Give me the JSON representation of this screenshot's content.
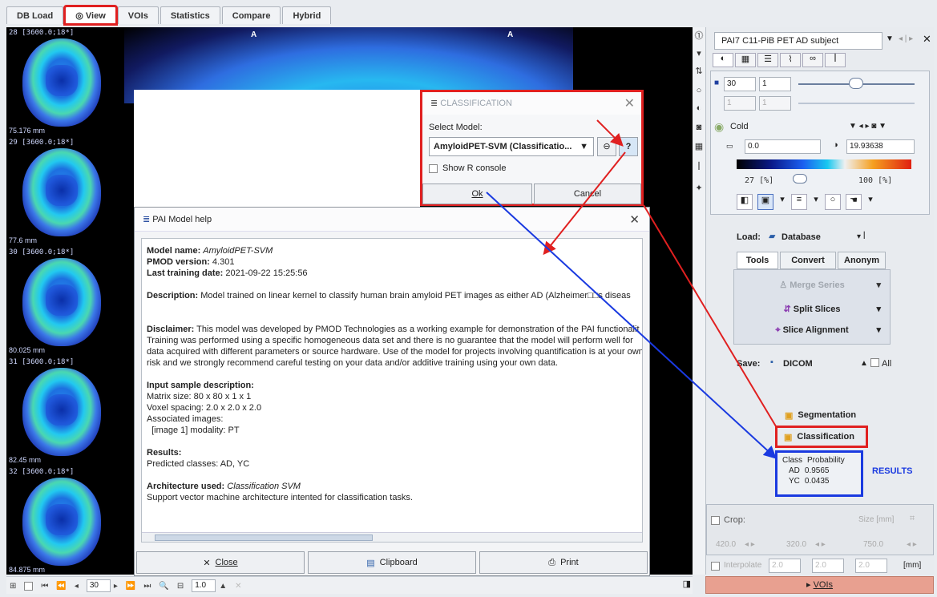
{
  "top_tabs": [
    {
      "label": "DB Load"
    },
    {
      "label": "View",
      "icon": "eye-icon"
    },
    {
      "label": "VOIs"
    },
    {
      "label": "Statistics"
    },
    {
      "label": "Compare"
    },
    {
      "label": "Hybrid"
    }
  ],
  "thumbnails": [
    {
      "label": "28 [3600.0;18*]",
      "mm": "75.176 mm"
    },
    {
      "label": "29 [3600.0;18*]",
      "mm": "77.6 mm"
    },
    {
      "label": "30 [3600.0;18*]",
      "mm": "80.025 mm"
    },
    {
      "label": "31 [3600.0;18*]",
      "mm": "82.45 mm"
    },
    {
      "label": "32 [3600.0;18*]",
      "mm": "84.875 mm"
    }
  ],
  "orientation_mark": "A",
  "classification_dialog": {
    "title": "CLASSIFICATION",
    "select_model_label": "Select Model:",
    "model_value": "AmyloidPET-SVM (Classificatio...",
    "show_r_console": "Show R console",
    "ok_label": "Ok",
    "cancel_label": "Cancel"
  },
  "help_dialog": {
    "title": "PAI Model help",
    "model_name_label": "Model name:",
    "model_name": "AmyloidPET-SVM",
    "pmod_version_label": "PMOD version:",
    "pmod_version": "4.301",
    "training_date_label": "Last training date:",
    "training_date": "2021-09-22 15:25:56",
    "description_label": "Description:",
    "description": "Model trained on linear kernel to classify human brain amyloid PET images as either AD (Alzheimer□□s diseas",
    "disclaimer_label": "Disclaimer:",
    "disclaimer_lines": [
      "This model was developed by PMOD Technologies as a working example for demonstration of the PAI functionalit",
      "Training was performed using a specific homogeneous data set and there is no guarantee that the model will perform well for",
      "data acquired with different parameters or source hardware. Use of the model for projects involving quantification is at your own",
      "risk and we strongly recommend careful testing on your data and/or additive training using your own data."
    ],
    "input_label": "Input sample description:",
    "input_lines": [
      "Matrix size: 80 x 80 x 1 x 1",
      "Voxel spacing: 2.0 x 2.0 x 2.0",
      "Associated images:",
      "  [image 1] modality: PT"
    ],
    "results_label": "Results:",
    "results_line": "Predicted classes: AD, YC",
    "architecture_label": "Architecture used:",
    "architecture": "Classification SVM",
    "architecture_line": "Support vector machine architecture intented for classification tasks.",
    "close_label": "Close",
    "clipboard_label": "Clipboard",
    "print_label": "Print"
  },
  "right_panel": {
    "series_title": "PAI7 C11-PiB PET AD subject",
    "slice_value": "30",
    "slice_step": "1",
    "slice2_value": "1",
    "slice2_step": "1",
    "colormap": "Cold",
    "min_value": "0.0",
    "max_value": "19.93638",
    "lower_pct": "27",
    "upper_pct": "100",
    "pct_unit": "[%]",
    "load_label": "Load:",
    "database_label": "Database",
    "subtabs": [
      "Tools",
      "Convert",
      "Anonym"
    ],
    "merge_series": "Merge Series",
    "split_slices": "Split Slices",
    "slice_alignment": "Slice Alignment",
    "save_label": "Save:",
    "dicom_label": "DICOM",
    "all_label": "All",
    "segmentation_label": "Segmentation",
    "classification_label": "Classification",
    "results_table": {
      "headers": [
        "Class",
        "Probability"
      ],
      "rows": [
        [
          "AD",
          "0.9565"
        ],
        [
          "YC",
          "0.0435"
        ]
      ]
    },
    "results_annotation": "RESULTS",
    "crop_label": "Crop:",
    "size_mm_label": "Size [mm]",
    "crop_values": [
      "420.0",
      "320.0",
      "750.0"
    ],
    "interpolate_label": "Interpolate",
    "interp_values": [
      "2.0",
      "2.0",
      "2.0"
    ],
    "mm_unit": "[mm]",
    "vois_label": "VOIs"
  },
  "bottom_bar": {
    "frame_value": "30",
    "zoom_value": "1.0"
  }
}
